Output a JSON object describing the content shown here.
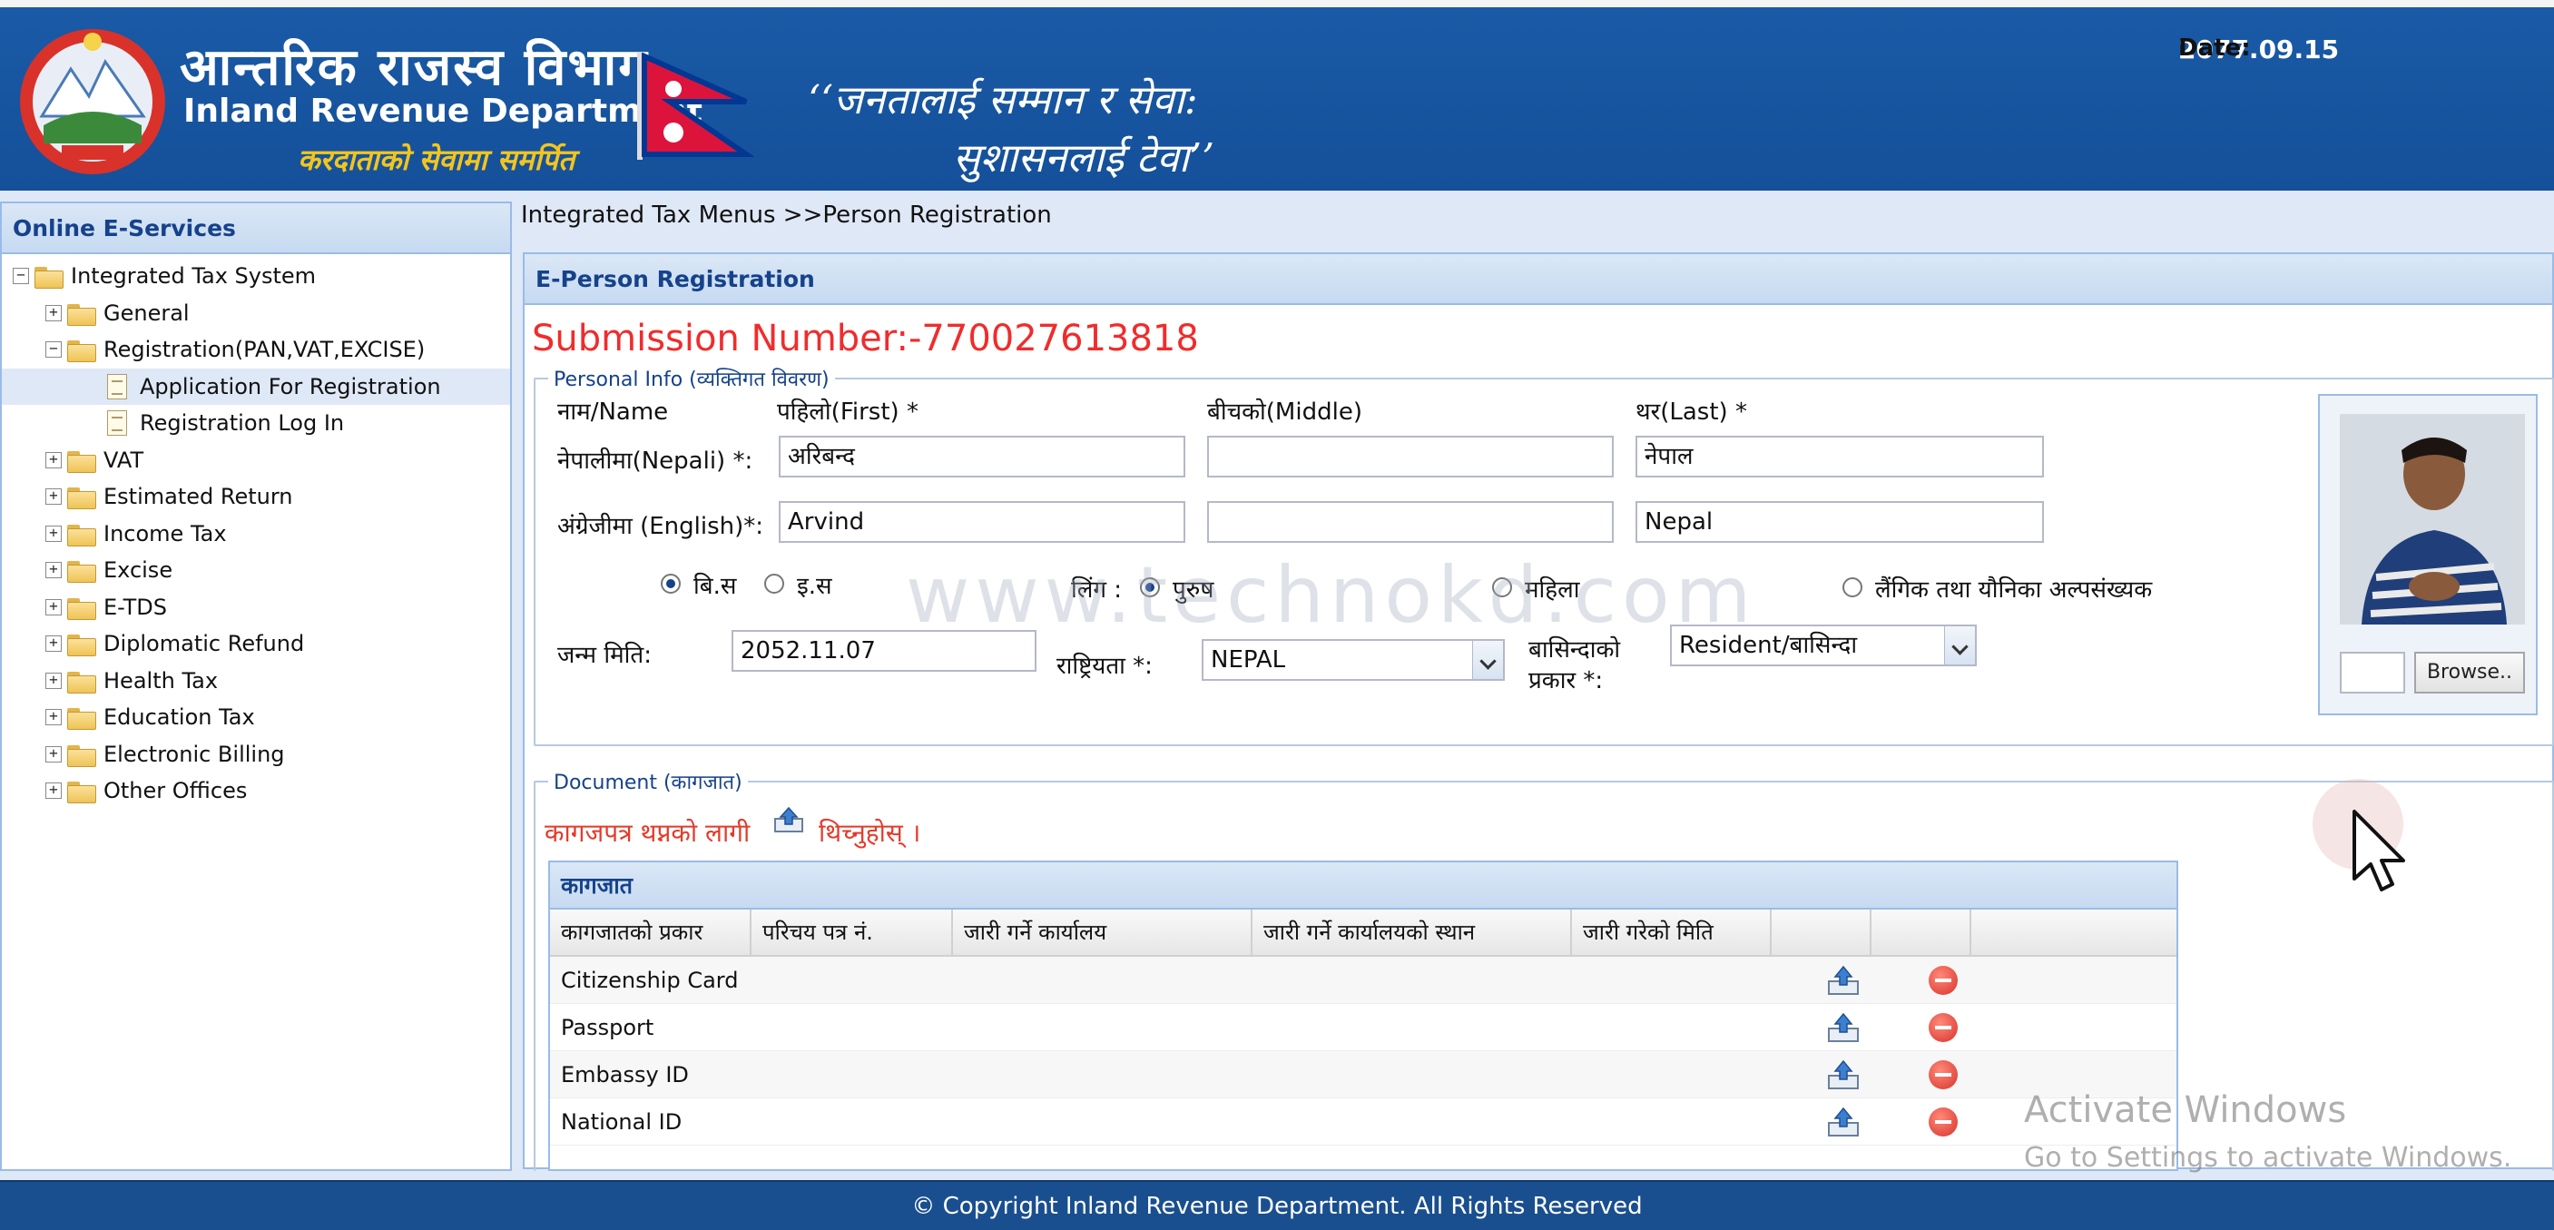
{
  "header": {
    "dept_name_np": "आन्तरिक राजस्व विभाग",
    "dept_name_en": "Inland Revenue Department",
    "dept_motto": "करदाताको सेवामा समर्पित",
    "slogan_line1": "‘‘जनतालाई सम्मान र सेवा:",
    "slogan_line2": "सुशासनलाई टेवा’’",
    "date_label": "Date:",
    "date_value": "2077.09.15"
  },
  "sidebar": {
    "title": "Online E-Services",
    "root": "Integrated Tax System",
    "items": [
      {
        "label": "General"
      },
      {
        "label": "Registration(PAN,VAT,EXCISE)"
      },
      {
        "label": "Application For Registration"
      },
      {
        "label": "Registration Log In"
      },
      {
        "label": "VAT"
      },
      {
        "label": "Estimated Return"
      },
      {
        "label": "Income Tax"
      },
      {
        "label": "Excise"
      },
      {
        "label": "E-TDS"
      },
      {
        "label": "Diplomatic Refund"
      },
      {
        "label": "Health Tax"
      },
      {
        "label": "Education Tax"
      },
      {
        "label": "Electronic Billing"
      },
      {
        "label": "Other Offices"
      }
    ]
  },
  "breadcrumb": "Integrated Tax Menus >>Person Registration",
  "panel_title": "E-Person Registration",
  "submission": "Submission Number:-770027613818",
  "personal": {
    "legend": "Personal Info (व्यक्तिगत विवरण)",
    "name_label": "नाम/Name",
    "first_label": "पहिलो(First) *",
    "middle_label": "बीचको(Middle)",
    "last_label": "थर(Last) *",
    "nepali_label": "नेपालीमा(Nepali) *:",
    "english_label": "अंग्रेजीमा (English)*:",
    "first_np": "अरिबन्द",
    "middle_np": "",
    "last_np": "नेपाल",
    "first_en": "Arvind",
    "middle_en": "",
    "last_en": "Nepal",
    "bs_label": "बि.स",
    "ad_label": "इ.स",
    "gender_label": "लिंग :",
    "male_label": "पुरुष",
    "female_label": "महिला",
    "other_label": "लैंगिक तथा यौनिका अल्पसंख्यक",
    "dob_label": "जन्म मिति:",
    "dob_value": "2052.11.07",
    "nationality_label": "राष्ट्रियता *:",
    "nationality_value": "NEPAL",
    "resident_label_1": "बासिन्दाको",
    "resident_label_2": "प्रकार *:",
    "resident_value": "Resident/बासिन्दा",
    "browse_label": "Browse.."
  },
  "watermark": "www.technokd.com",
  "document": {
    "legend": "Document (कागजात)",
    "upload_text_1": "कागजपत्र थप्नको लागी",
    "upload_text_2": "थिच्नुहोस् ।",
    "grid_title": "कागजात",
    "columns": [
      "कागजातको प्रकार",
      "परिचय पत्र नं.",
      "जारी गर्ने कार्यालय",
      "जारी गर्ने कार्यालयको स्थान",
      "जारी गरेको मिति",
      "",
      ""
    ],
    "rows": [
      "Citizenship Card",
      "Passport",
      "Embassy ID",
      "National ID"
    ]
  },
  "activate": {
    "title": "Activate Windows",
    "sub": "Go to Settings to activate Windows."
  },
  "footer": "© Copyright Inland Revenue Department. All Rights Reserved"
}
